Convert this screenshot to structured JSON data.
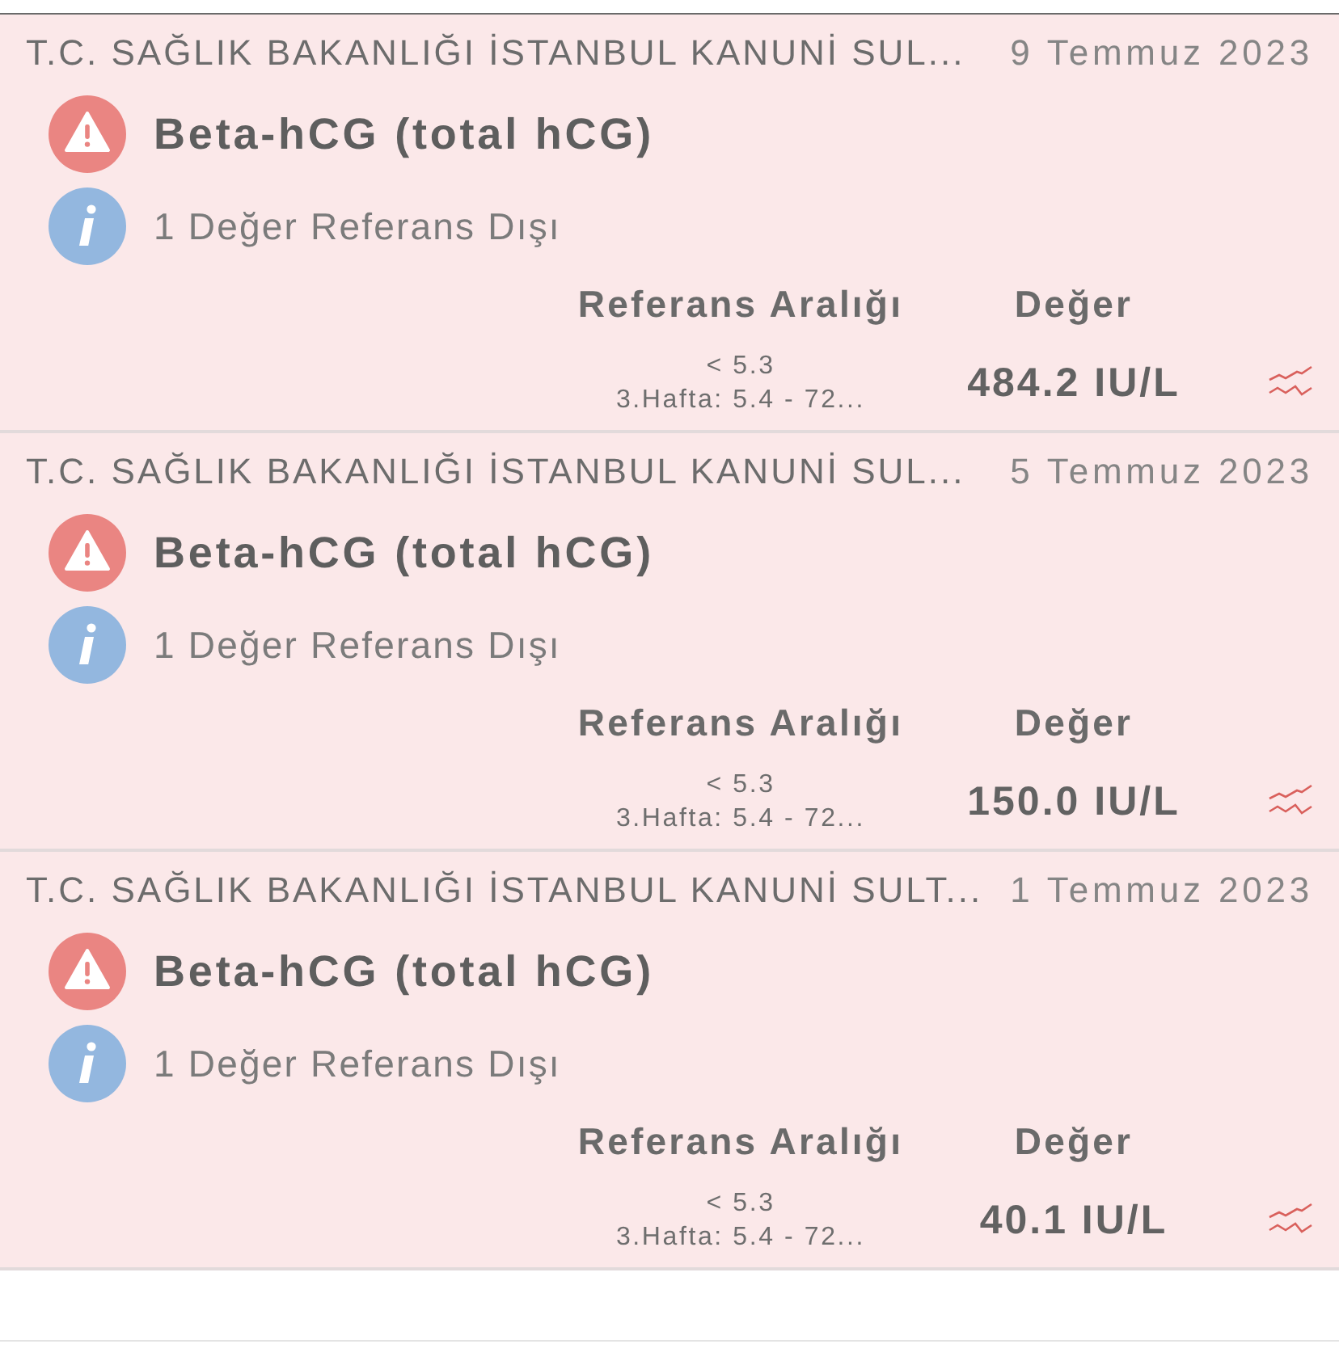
{
  "results": [
    {
      "lab": "T.C. SAĞLIK BAKANLIĞI İSTANBUL KANUNİ SUL...",
      "date": "9 Temmuz 2023",
      "test": "Beta-hCG (total hCG)",
      "out_of_range": true,
      "note": "1 Değer Referans Dışı",
      "range_header": "Referans Aralığı",
      "value_header": "Değer",
      "range_lines": [
        "< 5.3",
        "3.Hafta: 5.4 - 72..."
      ],
      "value": "484.2 IU/L"
    },
    {
      "lab": "T.C. SAĞLIK BAKANLIĞI İSTANBUL KANUNİ SUL...",
      "date": "5 Temmuz 2023",
      "test": "Beta-hCG (total hCG)",
      "out_of_range": true,
      "note": "1 Değer Referans Dışı",
      "range_header": "Referans Aralığı",
      "value_header": "Değer",
      "range_lines": [
        "< 5.3",
        "3.Hafta: 5.4 - 72..."
      ],
      "value": "150.0 IU/L"
    },
    {
      "lab": "T.C. SAĞLIK BAKANLIĞI İSTANBUL KANUNİ SULT...",
      "date": "1 Temmuz 2023",
      "test": "Beta-hCG (total hCG)",
      "out_of_range": true,
      "note": "1 Değer Referans Dışı",
      "range_header": "Referans Aralığı",
      "value_header": "Değer",
      "range_lines": [
        "< 5.3",
        "3.Hafta: 5.4 - 72..."
      ],
      "value": "40.1 IU/L"
    }
  ]
}
